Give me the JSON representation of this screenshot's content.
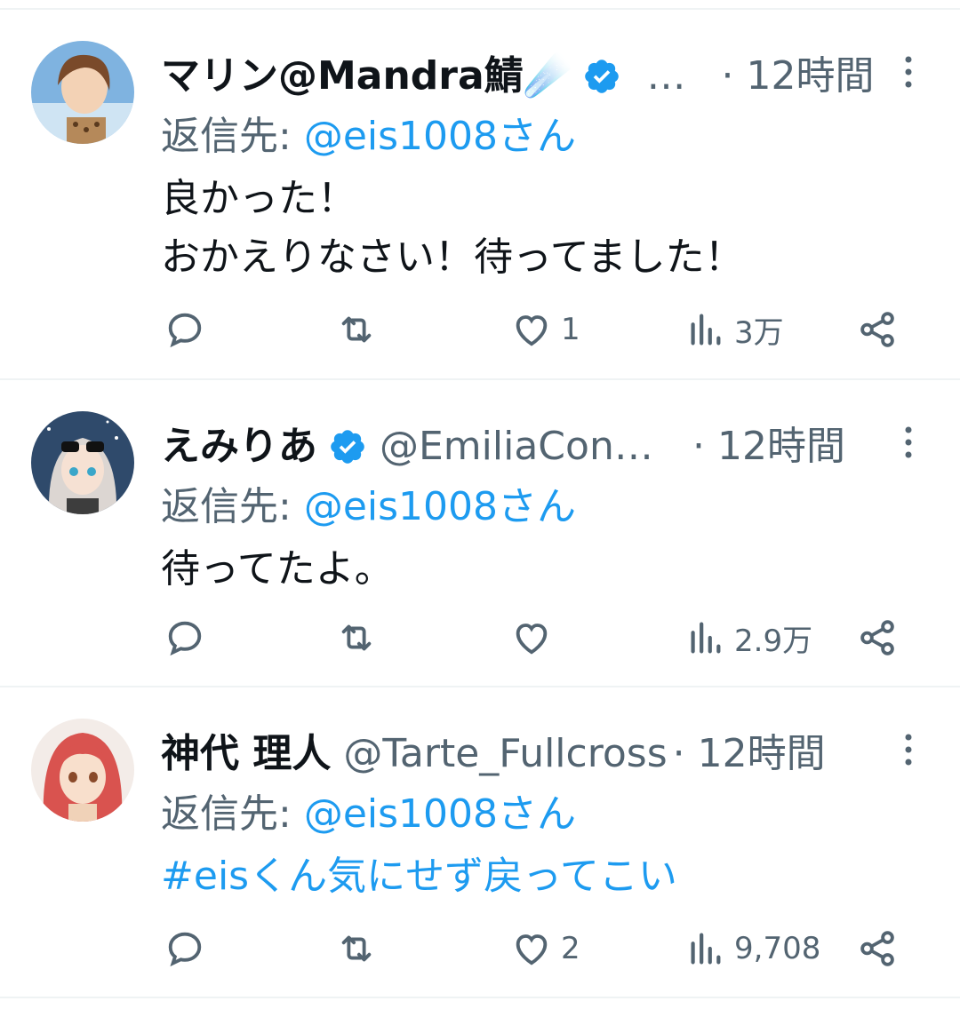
{
  "tweets": [
    {
      "name": "マリン@Mandra鯖☄️",
      "handle": "…",
      "time": "· 12時間",
      "reply_label": "返信先:",
      "reply_to": "@eis1008さん",
      "text": "良かった！\nおかえりなさい！待ってました！",
      "text_is_link": false,
      "likes": "1",
      "views": "3万",
      "avatar": {
        "bg": "#7fb3e0",
        "hair": "#7a4a2a",
        "skin": "#f3d2b5"
      }
    },
    {
      "name": "えみりあ",
      "handle": "@EmiliaCond...",
      "time": "· 12時間",
      "reply_label": "返信先:",
      "reply_to": "@eis1008さん",
      "text": "待ってたよ。",
      "text_is_link": false,
      "likes": "",
      "views": "2.9万",
      "avatar": {
        "bg": "#2f4a6b",
        "hair": "#dcd6d2",
        "skin": "#f6e1d3"
      }
    },
    {
      "name": "神代 理人",
      "handle": "@Tarte_Fullcross",
      "time": "· 12時間",
      "reply_label": "返信先:",
      "reply_to": "@eis1008さん",
      "text": "#eisくん気にせず戻ってこい",
      "text_is_link": true,
      "likes": "2",
      "views": "9,708",
      "avatar": {
        "bg": "#f3ece8",
        "hair": "#d9534f",
        "skin": "#f8dfcc"
      }
    }
  ],
  "colors": {
    "text": "#0f1419",
    "secondary": "#536471",
    "accent": "#1d9bf0",
    "divider": "#eff3f4"
  },
  "icons": [
    "reply-icon",
    "retweet-icon",
    "like-icon",
    "views-icon",
    "share-icon",
    "verified-badge-icon",
    "more-icon"
  ]
}
